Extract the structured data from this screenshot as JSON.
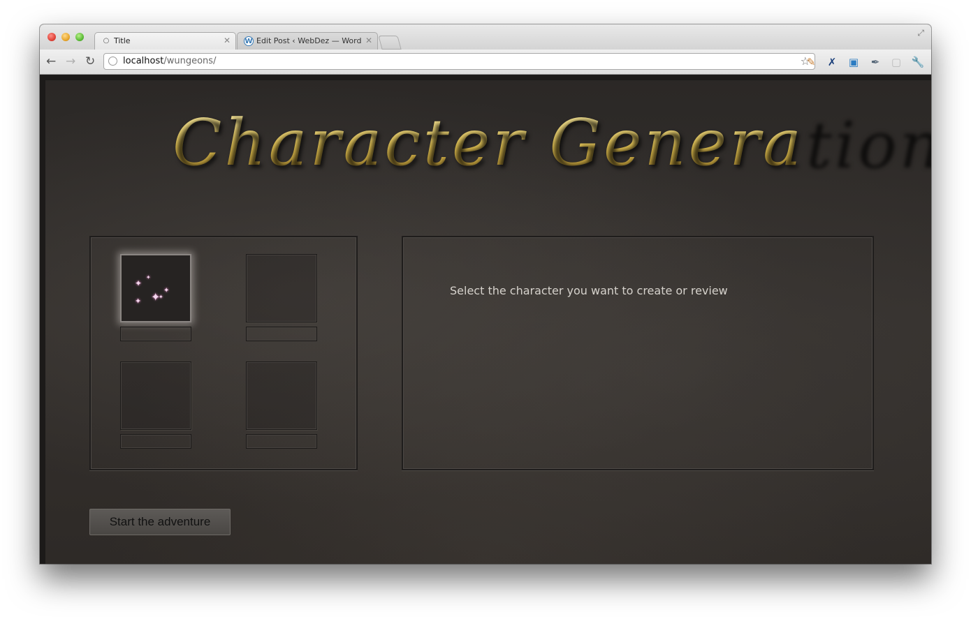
{
  "browser": {
    "tabs": [
      {
        "label": "Title",
        "active": true,
        "icon": "globe-icon"
      },
      {
        "label": "Edit Post ‹ WebDez — WordP",
        "active": false,
        "icon": "wordpress-icon"
      }
    ],
    "url": {
      "host": "localhost",
      "path": "/wungeons/"
    },
    "extensions": [
      "notes-icon",
      "x-icon",
      "screen-icon",
      "eyedropper-icon",
      "window-icon",
      "wrench-icon"
    ]
  },
  "page": {
    "title": "Character Generation",
    "prompt": "Select the character you want to create or review",
    "start_button": "Start the adventure",
    "slots": [
      {
        "name": "",
        "selected": true
      },
      {
        "name": "",
        "selected": false
      },
      {
        "name": "",
        "selected": false
      },
      {
        "name": "",
        "selected": false
      }
    ]
  },
  "colors": {
    "title_gold": "#e6cf73",
    "background": "#2e2a27",
    "prompt_text": "#d6d2cc"
  }
}
